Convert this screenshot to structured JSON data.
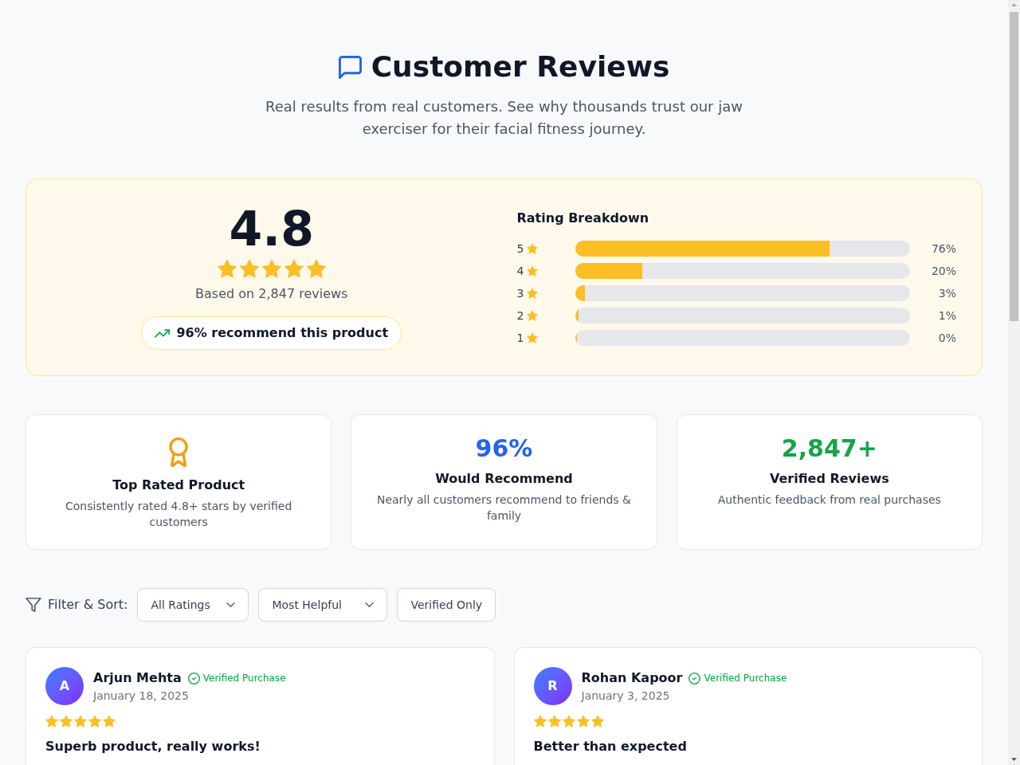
{
  "header": {
    "title": "Customer Reviews",
    "subtitle": "Real results from real customers. See why thousands trust our jaw exerciser for their facial fitness journey."
  },
  "summary": {
    "average": "4.8",
    "stars": 5,
    "based_on": "Based on 2,847 reviews",
    "recommend": "96% recommend this product",
    "breakdown_title": "Rating Breakdown",
    "breakdown": [
      {
        "label": "5",
        "level": 0.76,
        "reading": "76%"
      },
      {
        "label": "4",
        "level": 0.2,
        "reading": "20%"
      },
      {
        "label": "3",
        "level": 0.03,
        "reading": "3%"
      },
      {
        "label": "2",
        "level": 0.01,
        "reading": "1%"
      },
      {
        "label": "1",
        "level": 0.0,
        "reading": "0%"
      }
    ]
  },
  "highlights": [
    {
      "kind": "icon",
      "color": "#f59e0b",
      "title": "Top Rated Product",
      "description": "Consistently rated 4.8+ stars by verified customers"
    },
    {
      "kind": "figure",
      "value": "96%",
      "color": "#2563eb",
      "title": "Would Recommend",
      "description": "Nearly all customers recommend to friends & family"
    },
    {
      "kind": "figure",
      "value": "2,847+",
      "color": "#16a34a",
      "title": "Verified Reviews",
      "description": "Authentic feedback from real purchases"
    }
  ],
  "filters": {
    "label": "Filter & Sort:",
    "selects": [
      {
        "value": "All Ratings"
      },
      {
        "value": "Most Helpful"
      }
    ],
    "toggle": "Verified Only"
  },
  "reviews": [
    {
      "initial": "A",
      "name": "Arjun Mehta",
      "badge": "Verified Purchase",
      "date": "January 18, 2025",
      "stars": 5,
      "title": "Superb product, really works!"
    },
    {
      "initial": "R",
      "name": "Rohan Kapoor",
      "badge": "Verified Purchase",
      "date": "January 3, 2025",
      "stars": 5,
      "title": "Better than expected"
    }
  ]
}
